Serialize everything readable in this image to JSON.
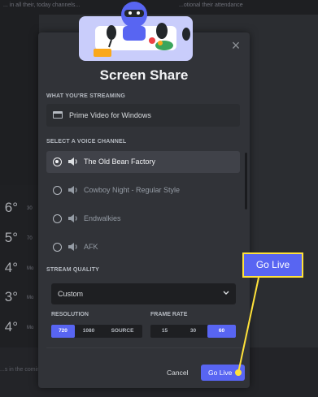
{
  "background": {
    "top_text": "... in all their, today channels...",
    "top_text_right": "...otional their attendance",
    "temps": [
      "6°",
      "5°",
      "4°",
      "3°",
      "4°"
    ],
    "temp_side_labels": [
      "30",
      "70",
      "Mo",
      "Mo",
      "Mo"
    ],
    "bottom_text": "...s in the coming..."
  },
  "modal": {
    "title": "Screen Share",
    "close_label": "×",
    "streaming": {
      "label": "WHAT YOU'RE STREAMING",
      "value": "Prime Video for Windows"
    },
    "voice": {
      "label": "SELECT A VOICE CHANNEL",
      "channels": [
        {
          "name": "The Old Bean Factory",
          "selected": true
        },
        {
          "name": "Cowboy Night - Regular Style",
          "selected": false
        },
        {
          "name": "Endwalkies",
          "selected": false
        },
        {
          "name": "AFK",
          "selected": false
        }
      ]
    },
    "quality": {
      "label": "STREAM QUALITY",
      "selected": "Custom",
      "resolution": {
        "label": "RESOLUTION",
        "options": [
          "720",
          "1080",
          "SOURCE"
        ],
        "active": "720"
      },
      "frame_rate": {
        "label": "FRAME RATE",
        "options": [
          "15",
          "30",
          "60"
        ],
        "active": "60"
      }
    },
    "cancel_label": "Cancel",
    "go_live_label": "Go Live"
  },
  "callout": {
    "label": "Go Live",
    "color": "#ffe23a",
    "fill": "#5865f2"
  },
  "colors": {
    "accent": "#5865f2",
    "modal_bg": "#313338",
    "selected_row": "#404249"
  }
}
